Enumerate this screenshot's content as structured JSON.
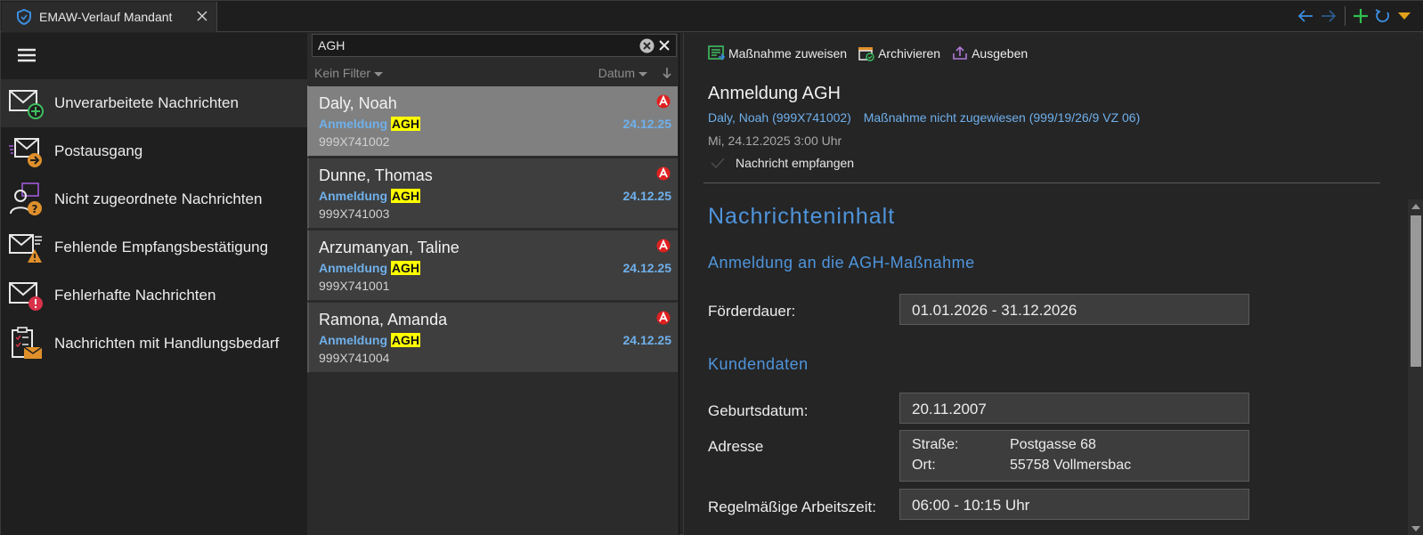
{
  "tab": {
    "title": "EMAW-Verlauf Mandant"
  },
  "nav": {
    "items": [
      {
        "label": "Unverarbeitete Nachrichten",
        "icon": "mail-add-icon"
      },
      {
        "label": "Postausgang",
        "icon": "mail-outbox-icon"
      },
      {
        "label": "Nicht zugeordnete Nachrichten",
        "icon": "person-question-icon"
      },
      {
        "label": "Fehlende Empfangsbestätigung",
        "icon": "mail-warning-icon"
      },
      {
        "label": "Fehlerhafte Nachrichten",
        "icon": "mail-error-icon"
      },
      {
        "label": "Nachrichten mit Handlungsbedarf",
        "icon": "clipboard-mail-icon"
      }
    ]
  },
  "list": {
    "search_value": "AGH",
    "filter_label": "Kein Filter",
    "sort_label": "Datum",
    "messages": [
      {
        "name": "Daly, Noah",
        "subject": "Anmeldung ",
        "highlight": "AGH",
        "date": "24.12.25",
        "id": "999X741002"
      },
      {
        "name": "Dunne, Thomas",
        "subject": "Anmeldung ",
        "highlight": "AGH",
        "date": "24.12.25",
        "id": "999X741003"
      },
      {
        "name": "Arzumanyan, Taline",
        "subject": "Anmeldung ",
        "highlight": "AGH",
        "date": "24.12.25",
        "id": "999X741001"
      },
      {
        "name": "Ramona, Amanda",
        "subject": "Anmeldung ",
        "highlight": "AGH",
        "date": "24.12.25",
        "id": "999X741004"
      }
    ]
  },
  "detail": {
    "toolbar": {
      "assign": "Maßnahme zuweisen",
      "archive": "Archivieren",
      "export": "Ausgeben"
    },
    "title": "Anmeldung AGH",
    "person": "Daly, Noah (999X741002)",
    "measure": "Maßnahme nicht zugewiesen (999/19/26/9 VZ 06)",
    "time": "Mi, 24.12.2025 3:00 Uhr",
    "status": "Nachricht empfangen",
    "content": {
      "heading": "Nachrichteninhalt",
      "section1": "Anmeldung an die AGH-Maßnahme",
      "duration_label": "Förderdauer:",
      "duration_value": "01.01.2026 - 31.12.2026",
      "section2": "Kundendaten",
      "dob_label": "Geburtsdatum:",
      "dob_value": "20.11.2007",
      "address_label": "Adresse",
      "street_key": "Straße:",
      "street_value": "Postgasse 68",
      "city_key": "Ort:",
      "city_value": "55758 Vollmersbac",
      "worktime_label": "Regelmäßige Arbeitszeit:",
      "worktime_value": "06:00 - 10:15 Uhr"
    }
  },
  "colors": {
    "accent": "#4f95dc",
    "link": "#6fb0ea",
    "highlight": "#ffff00",
    "selected_row": "#808080"
  }
}
